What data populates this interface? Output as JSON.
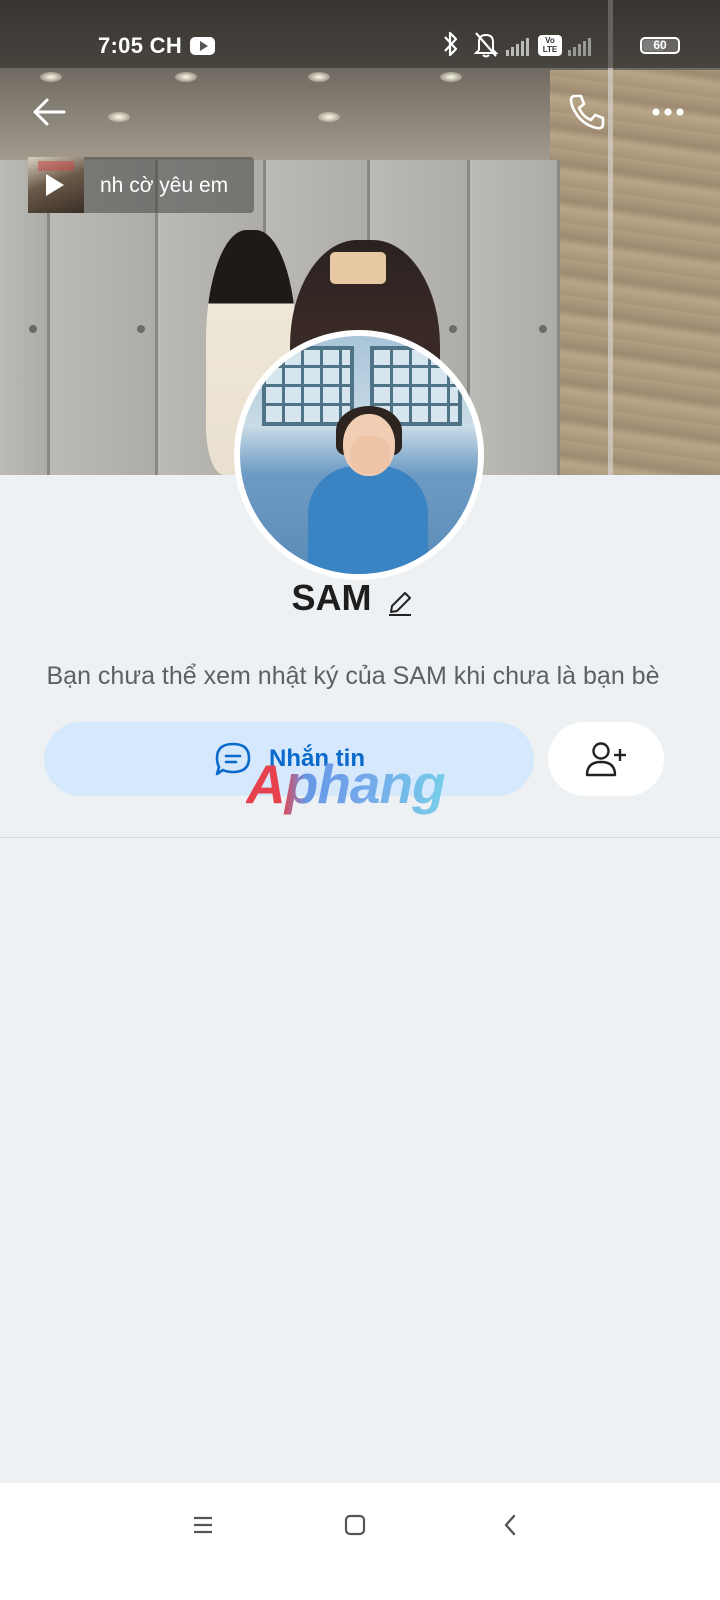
{
  "status_bar": {
    "time": "7:05 CH",
    "battery_level": "60",
    "volte_label": "Vo LTE"
  },
  "header": {
    "back_icon": "arrow-left-icon",
    "call_icon": "phone-icon",
    "more_icon": "more-horizontal-icon"
  },
  "music": {
    "title": "nh cờ yêu em",
    "play_icon": "play-icon"
  },
  "profile": {
    "name": "SAM",
    "edit_icon": "pencil-icon",
    "notice": "Bạn chưa thể xem nhật ký của SAM khi chưa là bạn bè"
  },
  "actions": {
    "message_label": "Nhắn tin",
    "message_icon": "chat-bubble-icon",
    "add_friend_icon": "user-plus-icon"
  },
  "watermark": "Aphang",
  "colors": {
    "accent": "#0a6acc",
    "button_bg": "#d6e8fb",
    "page_bg": "#eef1f3",
    "watermark_red": "#e8313b",
    "watermark_blue": "#5a8fe4"
  },
  "nav": {
    "menu_icon": "menu-icon",
    "home_icon": "square-home-icon",
    "back_icon": "chevron-left-icon"
  }
}
